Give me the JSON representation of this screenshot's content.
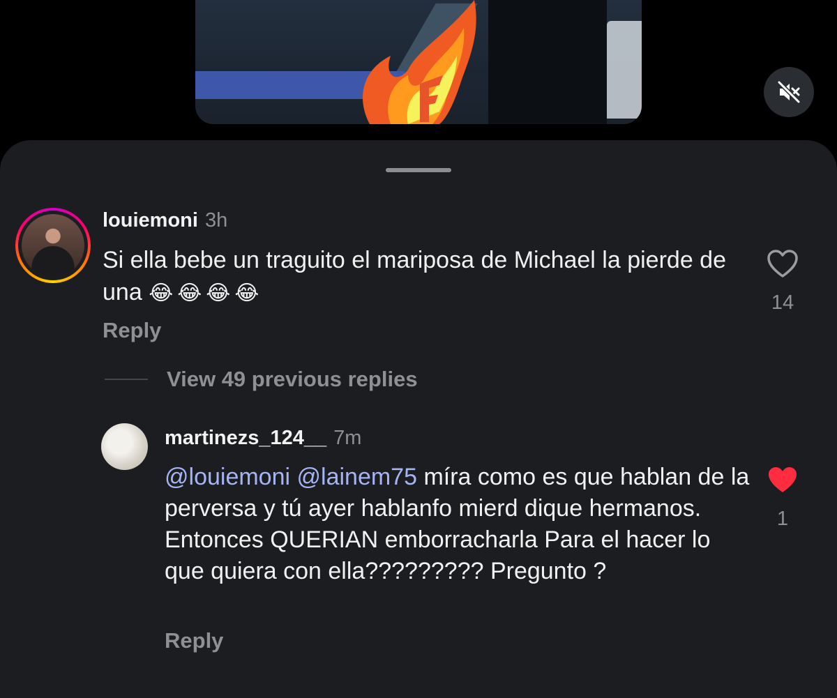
{
  "video": {
    "mute_icon": "speaker-muted-icon"
  },
  "comments": [
    {
      "username": "louiemoni",
      "time": "3h",
      "text": "Si ella bebe un traguito el mariposa de Michael la pierde de una",
      "emojis": "😂😂😂😂",
      "reply_label": "Reply",
      "like_count": "14",
      "liked": false
    },
    {
      "username": "martinezs_124__",
      "time": "7m",
      "mentions": [
        "@louiemoni",
        "@lainem75"
      ],
      "text": "míra como es que hablan de la perversa y tú ayer hablanfo mierd dique hermanos. Entonces QUERIAN emborracharla Para el hacer lo que quiera con ella????????? Pregunto ?",
      "reply_label": "Reply",
      "like_count": "1",
      "liked": true
    }
  ],
  "view_replies_label": "View 49 previous replies",
  "colors": {
    "sheet_bg": "#1b1d21",
    "mention": "#a6b4f4",
    "liked_heart": "#ff2d3f",
    "muted_text": "#8e9094"
  }
}
